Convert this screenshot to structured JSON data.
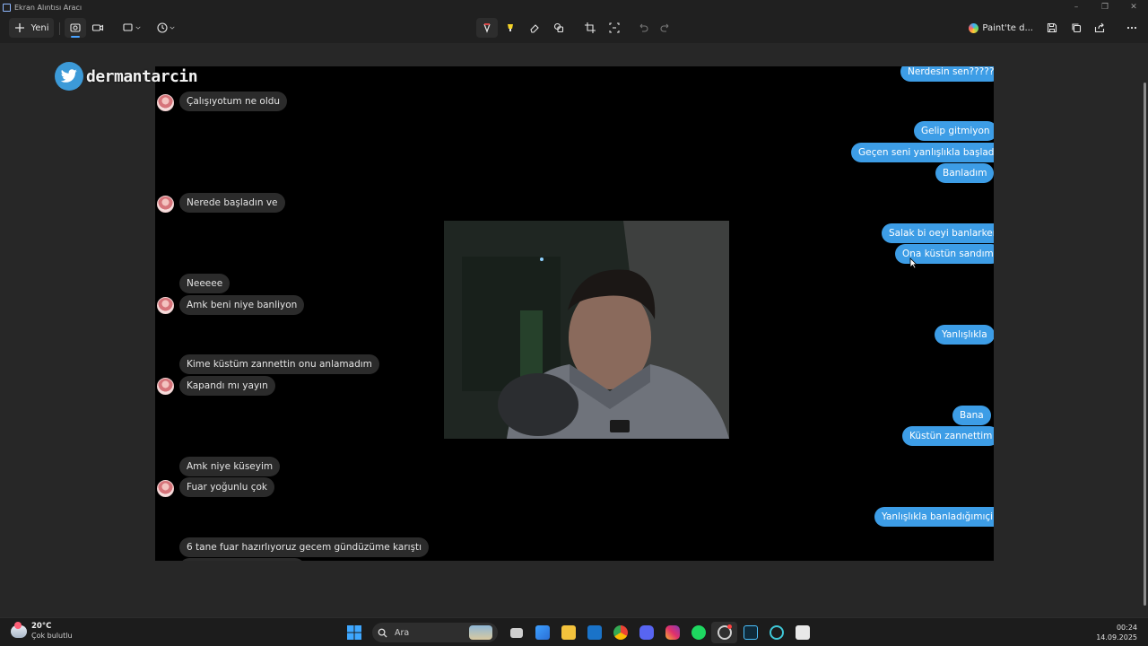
{
  "window": {
    "title": "Ekran Alıntısı Aracı",
    "controls": [
      "–",
      "❐",
      "✕"
    ]
  },
  "toolbar": {
    "new_label": "Yeni",
    "paint_label": "Paint'te d...",
    "accent": "#4aa3ff"
  },
  "watermark": {
    "text": "dermantarcin"
  },
  "chat": {
    "incoming": [
      "Çalışıyotum ne oldu",
      "Nerede başladın ve",
      "Neeeee",
      "Amk beni niye banliyon",
      "Kime küstüm zannettin onu anlamadım",
      "Kapandı mı yayın",
      "Amk niye küseyim",
      "Fuar yoğunlu çok",
      "6 tane fuar hazırlıyoruz gecem gündüzüme karıştı"
    ],
    "outgoing": [
      "Nerdesin sen?????",
      "Gelip gitmiyon",
      "Geçen seni yanlışlıkla başladım",
      "Banladım",
      "Salak bi oeyi banlarken",
      "Ona küstün sandım",
      "Yanlışlıkla",
      "Bana",
      "Küstün zannettim",
      "Yanlışlıkla banladığımıçin"
    ],
    "outgoing_color": "#3d9de6",
    "incoming_color": "#2b2b2b"
  },
  "taskbar": {
    "weather_temp": "20°C",
    "weather_desc": "Çok bulutlu",
    "search_placeholder": "Ara",
    "time": "00:24",
    "date": "14.09.2025"
  }
}
